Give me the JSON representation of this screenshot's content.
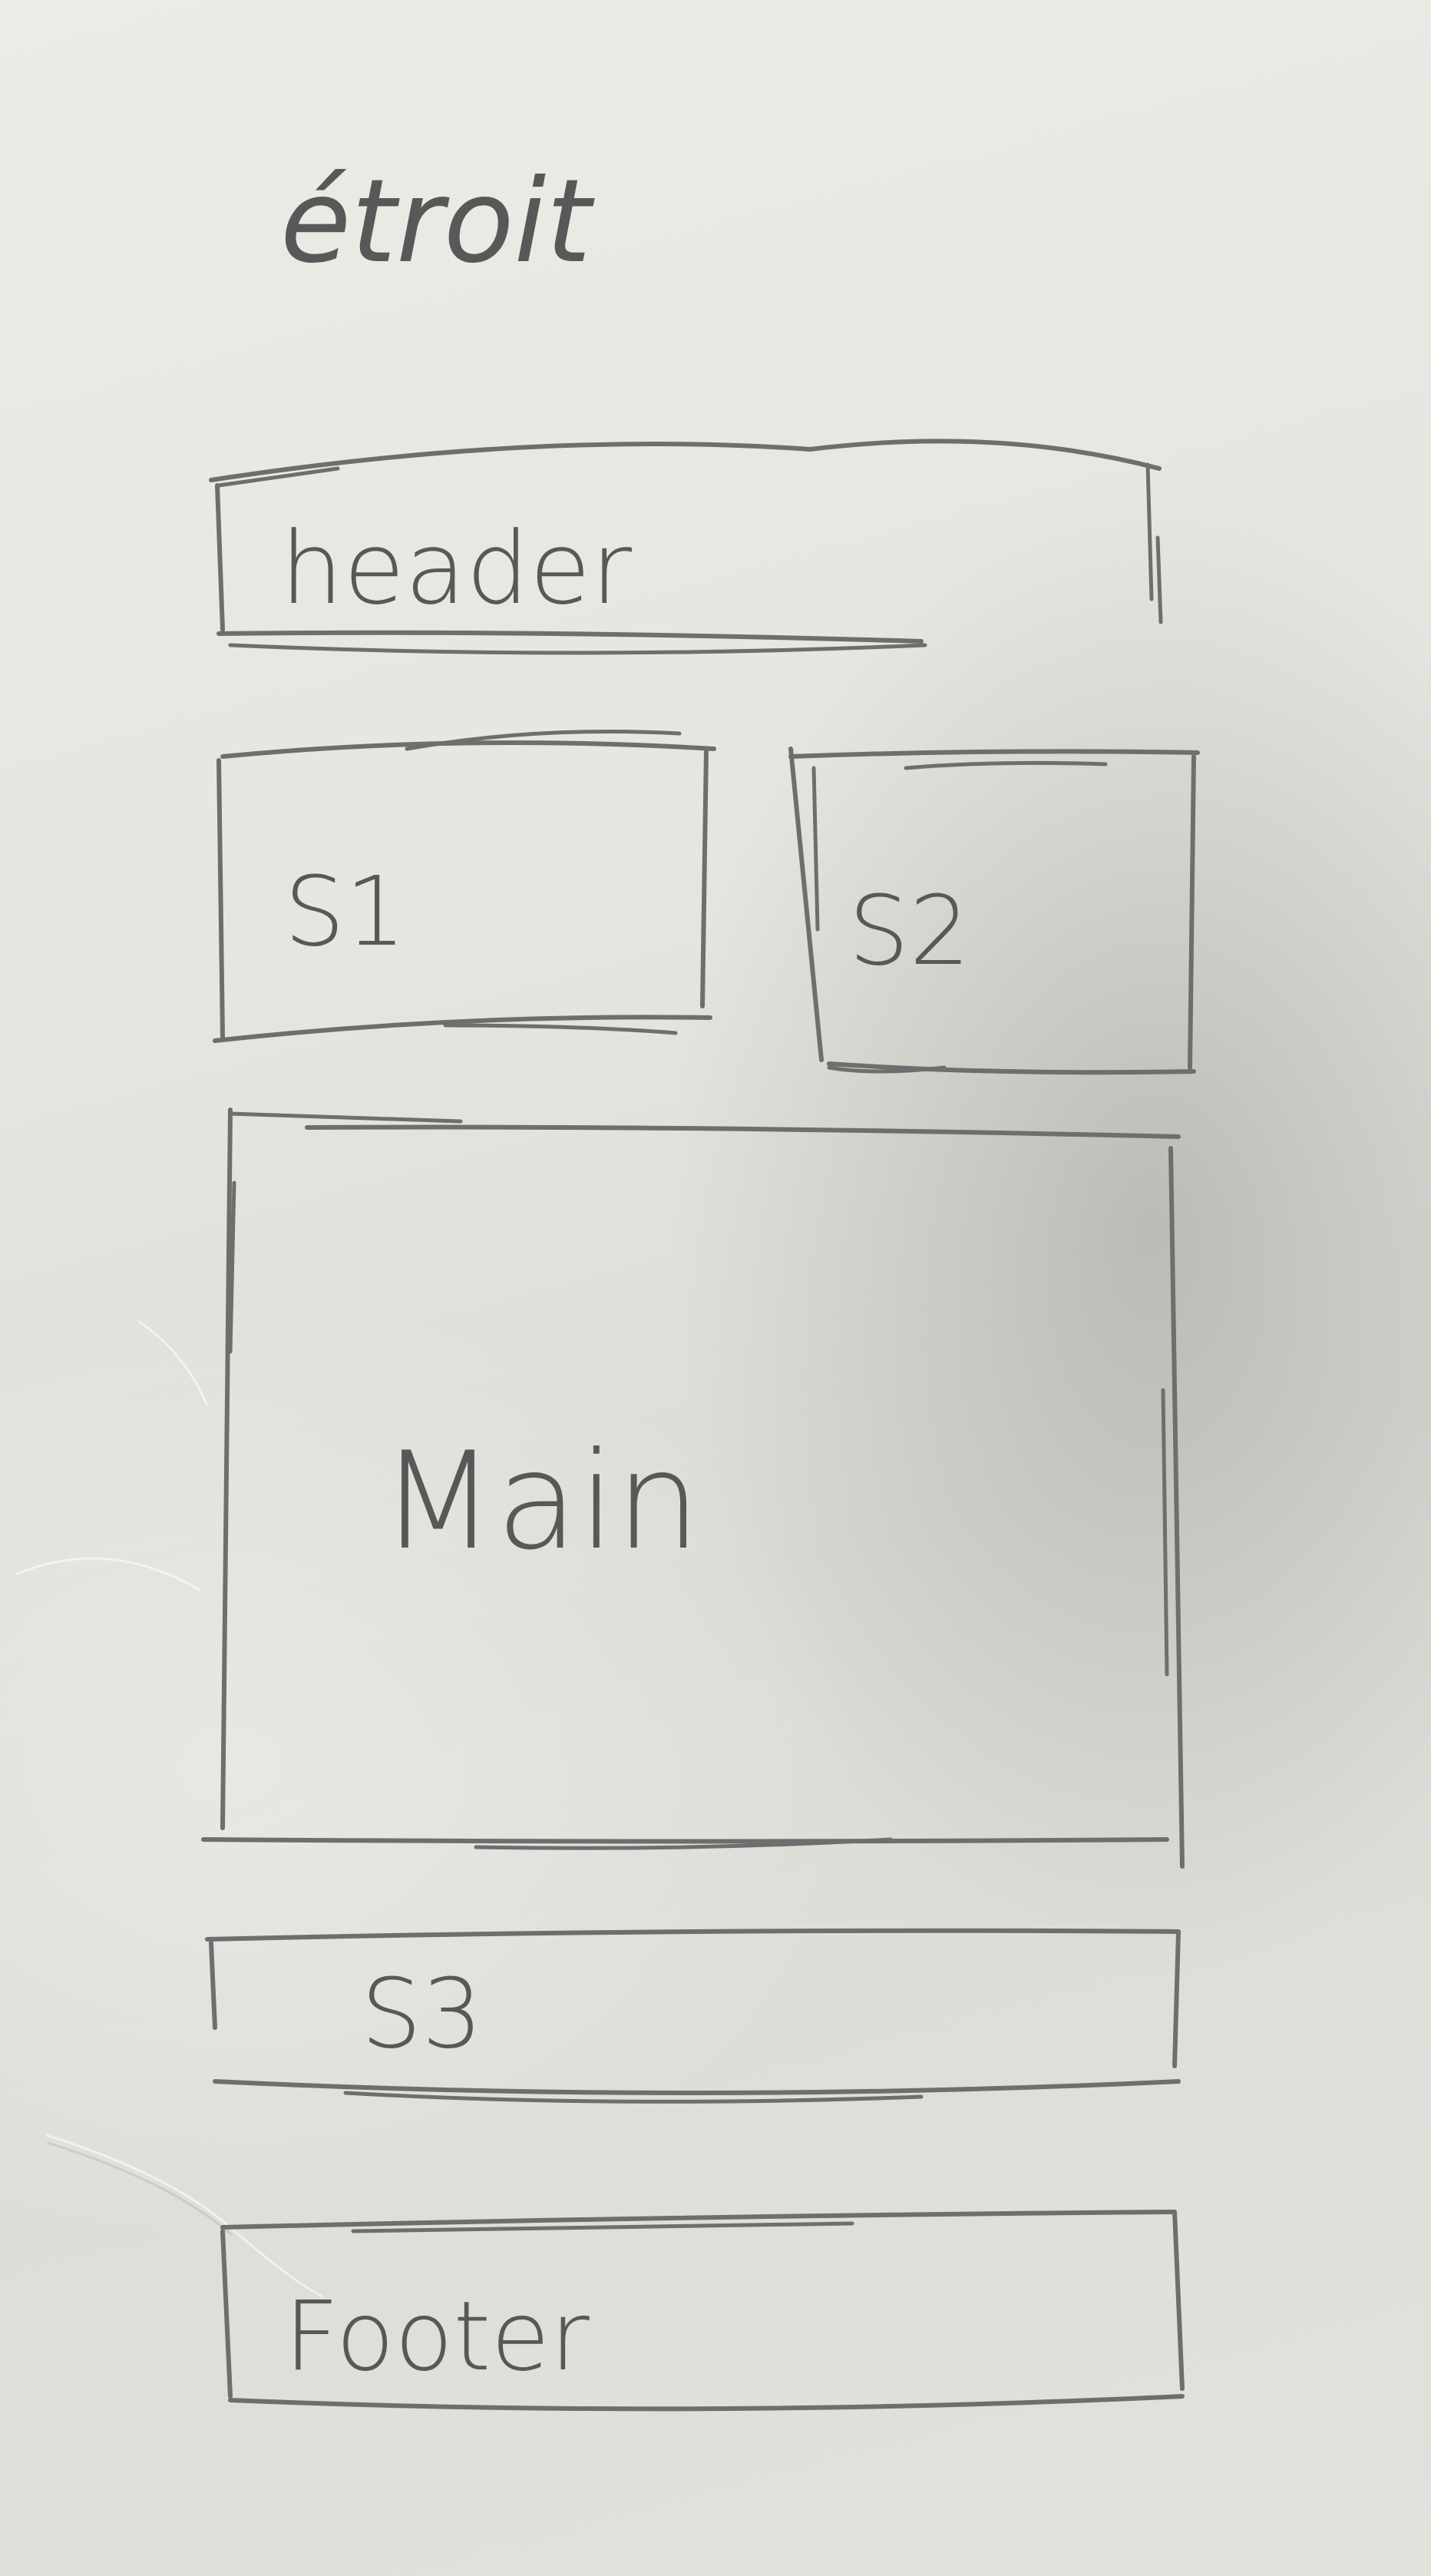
{
  "page_title": "étroit",
  "blocks": {
    "header": "header",
    "s1": "S1",
    "s2": "S2",
    "main": "Main",
    "s3": "S3",
    "footer": "Footer"
  }
}
